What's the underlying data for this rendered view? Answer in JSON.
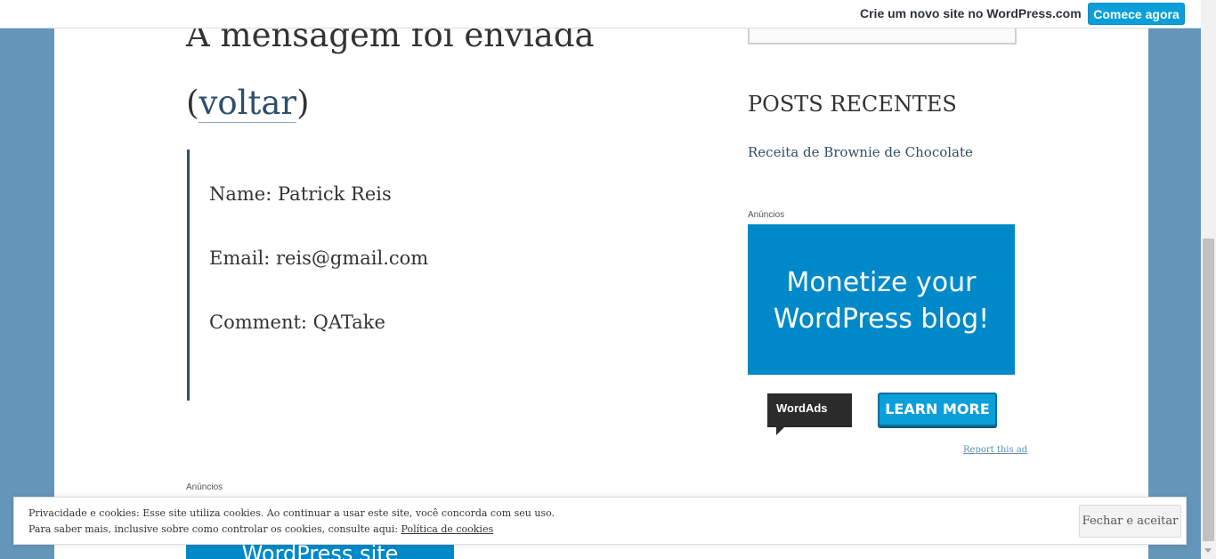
{
  "top_bar": {
    "promo_text": "Crie um novo site no WordPress.com",
    "cta_label": "Comece agora"
  },
  "main": {
    "heading": "A mensagem foi enviada",
    "back_open": "(",
    "back_link": "voltar",
    "back_close": ")",
    "submission": {
      "name": "Name: Patrick Reis",
      "email": "Email: reis@gmail.com",
      "comment": "Comment: QATake"
    },
    "ads_label": "Anúncios",
    "ad_text": "WordPress site"
  },
  "sidebar": {
    "recent_title": "POSTS RECENTES",
    "recent_posts": [
      "Receita de Brownie de Chocolate"
    ],
    "ads_label": "Anúncios",
    "ad_line1": "Monetize your",
    "ad_line2": "WordPress blog!",
    "wordads_label": "WordAds",
    "learn_more_label": "LEARN MORE",
    "report_label": "Report this ad"
  },
  "cookie_bar": {
    "line1": "Privacidade e cookies: Esse site utiliza cookies. Ao continuar a usar este site, você concorda com seu uso.",
    "line2_prefix": "Para saber mais, inclusive sobre como controlar os cookies, consulte aqui: ",
    "line2_link": "Política de cookies",
    "button_label": "Fechar e aceitar"
  },
  "colors": {
    "background": "#6496b9",
    "link": "#2f4e6a",
    "accent": "#0b9fda",
    "ad_blue": "#0089c8"
  }
}
